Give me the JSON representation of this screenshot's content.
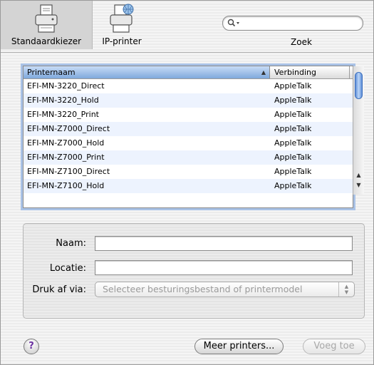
{
  "toolbar": {
    "items": [
      {
        "label": "Standaardkiezer"
      },
      {
        "label": "IP-printer"
      }
    ],
    "search_label": "Zoek",
    "search_value": ""
  },
  "table": {
    "columns": [
      "Printernaam",
      "Verbinding"
    ],
    "rows": [
      {
        "name": "EFI-MN-3220_Direct",
        "connection": "AppleTalk"
      },
      {
        "name": "EFI-MN-3220_Hold",
        "connection": "AppleTalk"
      },
      {
        "name": "EFI-MN-3220_Print",
        "connection": "AppleTalk"
      },
      {
        "name": "EFI-MN-Z7000_Direct",
        "connection": "AppleTalk"
      },
      {
        "name": "EFI-MN-Z7000_Hold",
        "connection": "AppleTalk"
      },
      {
        "name": "EFI-MN-Z7000_Print",
        "connection": "AppleTalk"
      },
      {
        "name": "EFI-MN-Z7100_Direct",
        "connection": "AppleTalk"
      },
      {
        "name": "EFI-MN-Z7100_Hold",
        "connection": "AppleTalk"
      }
    ]
  },
  "form": {
    "name_label": "Naam:",
    "name_value": "",
    "location_label": "Locatie:",
    "location_value": "",
    "print_via_label": "Druk af via:",
    "print_via_value": "Selecteer besturingsbestand of printermodel"
  },
  "buttons": {
    "help": "?",
    "more_printers": "Meer printers...",
    "add": "Voeg toe"
  }
}
